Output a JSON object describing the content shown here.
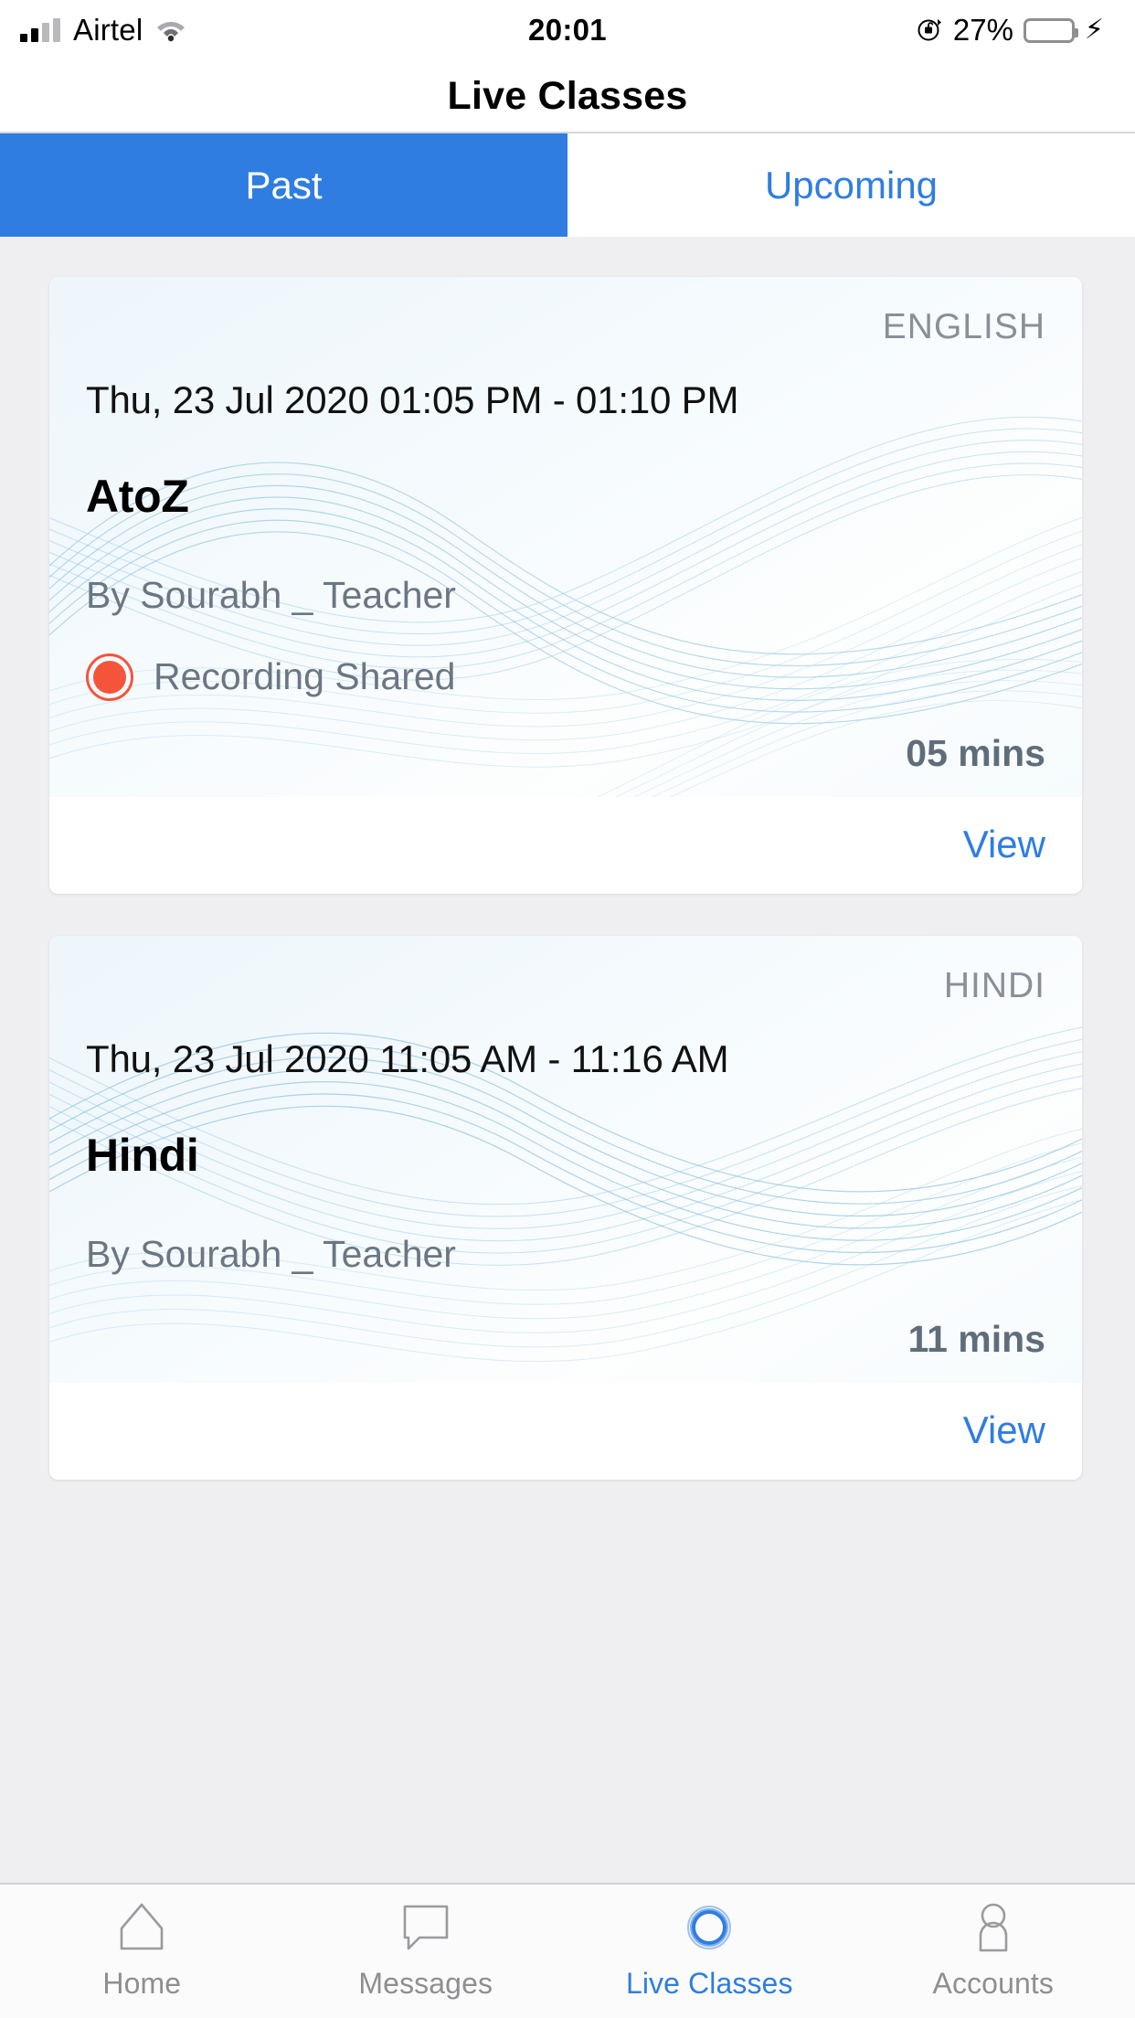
{
  "status_bar": {
    "carrier": "Airtel",
    "signal_icon": "cellular-signal-icon",
    "wifi_icon": "wifi-icon",
    "time": "20:01",
    "rotation_lock_icon": "rotation-lock-icon",
    "battery_percent": "27%",
    "battery_level": 27,
    "battery_icon": "battery-icon",
    "charging_icon": "lightning-bolt-icon"
  },
  "header": {
    "title": "Live Classes"
  },
  "segmented_tabs": [
    {
      "label": "Past",
      "active": true
    },
    {
      "label": "Upcoming",
      "active": false
    }
  ],
  "classes": [
    {
      "subject": "ENGLISH",
      "datetime": "Thu, 23 Jul 2020 01:05 PM - 01:10 PM",
      "title": "AtoZ",
      "teacher": "By Sourabh _ Teacher",
      "recording_status": "Recording Shared",
      "recording_icon": "record-circle-icon",
      "duration": "05 mins",
      "action": "View"
    },
    {
      "subject": "HINDI",
      "datetime": "Thu, 23 Jul 2020 11:05 AM - 11:16 AM",
      "title": "Hindi",
      "teacher": "By Sourabh _ Teacher",
      "recording_status": null,
      "duration": "11 mins",
      "action": "View"
    }
  ],
  "bottom_nav": [
    {
      "label": "Home",
      "icon": "home-icon",
      "active": false
    },
    {
      "label": "Messages",
      "icon": "message-bubble-icon",
      "active": false
    },
    {
      "label": "Live Classes",
      "icon": "live-circle-icon",
      "active": true
    },
    {
      "label": "Accounts",
      "icon": "person-icon",
      "active": false
    }
  ],
  "colors": {
    "accent_blue": "#2f7de1",
    "record_orange": "#f4553a",
    "page_background": "#EFEFF1",
    "muted_text": "#8e8e93",
    "battery_green": "#3ad449"
  }
}
